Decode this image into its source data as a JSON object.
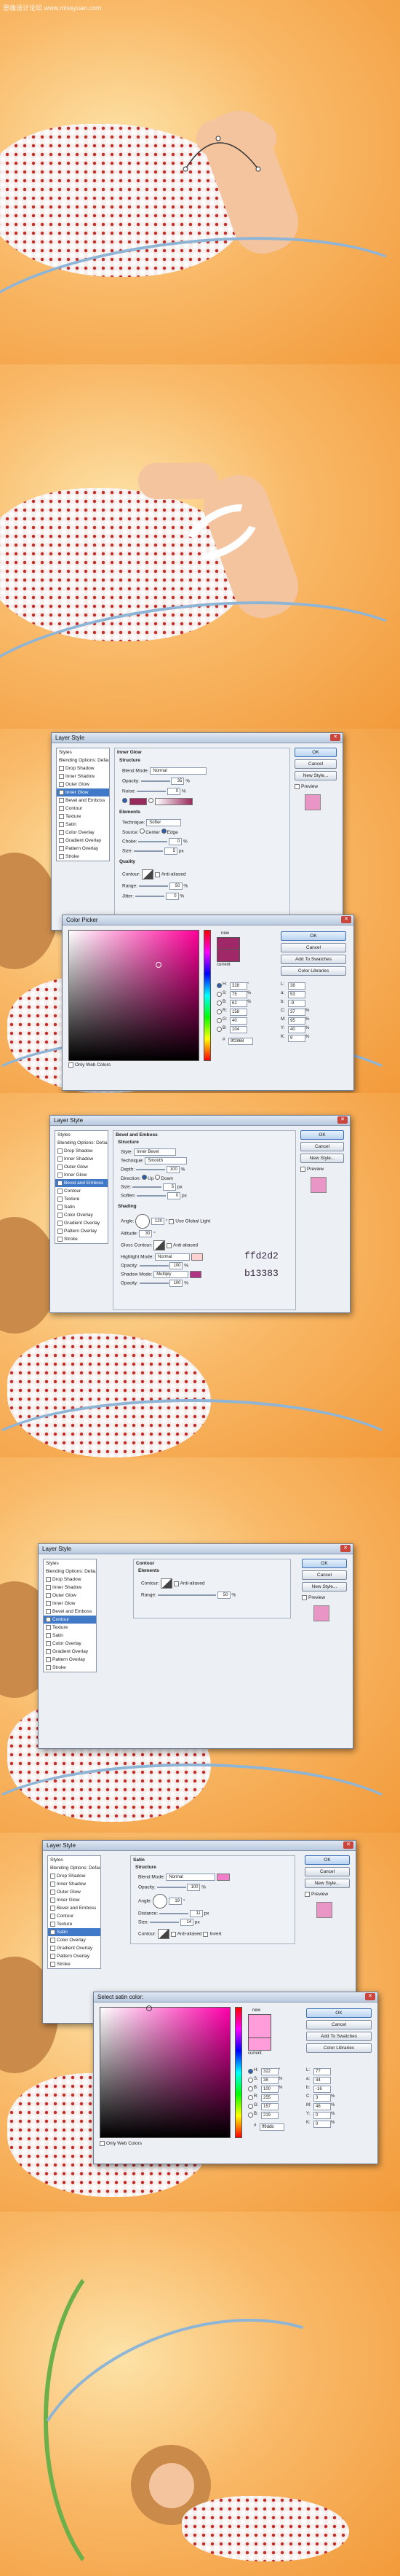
{
  "watermark": "思缘设计论坛 www.missyuan.com",
  "panels": {
    "p1": {
      "label": "panel-1-path-on-leg"
    },
    "p2": {
      "label": "panel-2-ring-on-leg"
    }
  },
  "layer_style_1": {
    "title": "Layer Style",
    "styles_list": [
      "Styles",
      "Blending Options: Default",
      "Drop Shadow",
      "Inner Shadow",
      "Outer Glow",
      "Inner Glow",
      "Bevel and Emboss",
      "Contour",
      "Texture",
      "Satin",
      "Color Overlay",
      "Gradient Overlay",
      "Pattern Overlay",
      "Stroke"
    ],
    "selected_index": 5,
    "section_title": "Inner Glow",
    "structure_label": "Structure",
    "blend_mode_label": "Blend Mode:",
    "blend_mode_value": "Normal",
    "opacity_label": "Opacity:",
    "opacity_value": "35",
    "noise_label": "Noise:",
    "noise_value": "0",
    "elements_label": "Elements",
    "technique_label": "Technique:",
    "technique_value": "Softer",
    "source_label": "Source:",
    "source_center": "Center",
    "source_edge": "Edge",
    "choke_label": "Choke:",
    "choke_value": "0",
    "size_label": "Size:",
    "size_value": "5",
    "quality_label": "Quality",
    "contour_label": "Contour:",
    "antialiased_label": "Anti-aliased",
    "range_label": "Range:",
    "range_value": "50",
    "jitter_label": "Jitter:",
    "jitter_value": "0",
    "ok": "OK",
    "cancel": "Cancel",
    "new_style": "New Style...",
    "preview": "Preview",
    "color": "#9a2a5e"
  },
  "color_picker_1": {
    "title": "Color Picker",
    "new_label": "new",
    "current_label": "current",
    "ok": "OK",
    "cancel": "Cancel",
    "add_swatches": "Add To Swatches",
    "color_libraries": "Color Libraries",
    "only_web": "Only Web Colors",
    "H": "328",
    "S": "75",
    "B": "62",
    "R": "158",
    "G": "40",
    "Bv": "104",
    "L": "38",
    "a": "53",
    "b": "-9",
    "C": "37",
    "M": "95",
    "Y": "40",
    "K": "9",
    "hex": "9f2868",
    "color": "#9e2868"
  },
  "layer_style_2": {
    "title": "Layer Style",
    "styles_list": [
      "Styles",
      "Blending Options: Default",
      "Drop Shadow",
      "Inner Shadow",
      "Outer Glow",
      "Inner Glow",
      "Bevel and Emboss",
      "Contour",
      "Texture",
      "Satin",
      "Color Overlay",
      "Gradient Overlay",
      "Pattern Overlay",
      "Stroke"
    ],
    "selected_index": 6,
    "section_title": "Bevel and Emboss",
    "structure_label": "Structure",
    "style_label": "Style:",
    "style_value": "Inner Bevel",
    "technique_label": "Technique:",
    "technique_value": "Smooth",
    "depth_label": "Depth:",
    "depth_value": "100",
    "direction_label": "Direction:",
    "dir_up": "Up",
    "dir_down": "Down",
    "size_label": "Size:",
    "size_value": "5",
    "soften_label": "Soften:",
    "soften_value": "0",
    "shading_label": "Shading",
    "angle_label": "Angle:",
    "angle_value": "120",
    "global_light": "Use Global Light",
    "altitude_label": "Altitude:",
    "altitude_value": "30",
    "gloss_label": "Gloss Contour:",
    "antialiased_label": "Anti-aliased",
    "highlight_label": "Highlight Mode:",
    "highlight_value": "Normal",
    "opacity_label": "Opacity:",
    "opacity1_value": "100",
    "shadow_label": "Shadow Mode:",
    "shadow_value": "Multiply",
    "opacity2_value": "100",
    "highlight_hex": "ffd2d2",
    "shadow_hex": "b13383",
    "highlight_color": "#ffd2d2",
    "shadow_color": "#b13383",
    "ok": "OK",
    "cancel": "Cancel",
    "new_style": "New Style...",
    "preview": "Preview"
  },
  "layer_style_3": {
    "title": "Layer Style",
    "styles_list": [
      "Styles",
      "Blending Options: Default",
      "Drop Shadow",
      "Inner Shadow",
      "Outer Glow",
      "Inner Glow",
      "Bevel and Emboss",
      "Contour",
      "Texture",
      "Satin",
      "Color Overlay",
      "Gradient Overlay",
      "Pattern Overlay",
      "Stroke"
    ],
    "selected_index": 7,
    "section_title": "Contour",
    "elements_label": "Elements",
    "contour_label": "Contour:",
    "antialiased_label": "Anti-aliased",
    "range_label": "Range:",
    "range_value": "50",
    "ok": "OK",
    "cancel": "Cancel",
    "new_style": "New Style...",
    "preview": "Preview"
  },
  "layer_style_4": {
    "title": "Layer Style",
    "styles_list": [
      "Styles",
      "Blending Options: Default",
      "Drop Shadow",
      "Inner Shadow",
      "Outer Glow",
      "Inner Glow",
      "Bevel and Emboss",
      "Contour",
      "Texture",
      "Satin",
      "Color Overlay",
      "Gradient Overlay",
      "Pattern Overlay",
      "Stroke"
    ],
    "selected_index": 9,
    "section_title": "Satin",
    "structure_label": "Structure",
    "blend_mode_label": "Blend Mode:",
    "blend_mode_value": "Normal",
    "opacity_label": "Opacity:",
    "opacity_value": "100",
    "angle_label": "Angle:",
    "angle_value": "19",
    "distance_label": "Distance:",
    "distance_value": "11",
    "size_label": "Size:",
    "size_value": "14",
    "contour_label": "Contour:",
    "antialiased_label": "Anti-aliased",
    "invert_label": "Invert",
    "satin_color": "#f07ec8",
    "ok": "OK",
    "cancel": "Cancel",
    "new_style": "New Style...",
    "preview": "Preview"
  },
  "color_picker_2": {
    "title": "Select satin color:",
    "new_label": "new",
    "current_label": "current",
    "ok": "OK",
    "cancel": "Cancel",
    "add_swatches": "Add To Swatches",
    "color_libraries": "Color Libraries",
    "only_web": "Only Web Colors",
    "H": "322",
    "S": "38",
    "B": "100",
    "R": "255",
    "G": "157",
    "Bv": "219",
    "L": "77",
    "a": "44",
    "b": "-16",
    "C": "3",
    "M": "46",
    "Y": "0",
    "K": "0",
    "hex": "ff9ddb",
    "color": "#ff9ddb"
  }
}
